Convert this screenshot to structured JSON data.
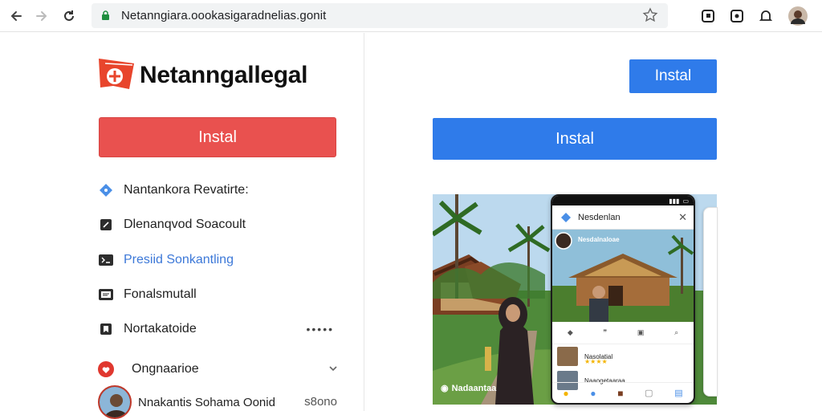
{
  "browser": {
    "url": "Netanngiara.oookasigaradnelias.gonit",
    "back_icon": "arrow-left-icon",
    "forward_icon": "arrow-right-icon",
    "reload_icon": "reload-icon",
    "bookmark_icon": "star-icon"
  },
  "app": {
    "title": "Netanngallegal",
    "install_primary": "Instal"
  },
  "menu": {
    "items": [
      {
        "label": "Nantankora Revatirte:",
        "icon": "tag-icon",
        "link": false
      },
      {
        "label": "Dlenanqvod Soacoult",
        "icon": "edit-icon",
        "link": false
      },
      {
        "label": "Presiid Sonkantling",
        "icon": "terminal-icon",
        "link": true
      },
      {
        "label": "Fonalsmutall",
        "icon": "screen-icon",
        "link": false
      },
      {
        "label": "Nortakatoide",
        "icon": "bookmark-icon",
        "more": "•••••",
        "link": false
      },
      {
        "label": "Ongnaarioe",
        "icon": "heart-icon",
        "link": false
      }
    ]
  },
  "account": {
    "name": "Nnakantis Sohama Oonid",
    "count": "s8ono"
  },
  "right": {
    "install_small": "Instal",
    "install_large": "Instal"
  },
  "preview": {
    "card_title": "Nesdenlan",
    "post_caption": "Nesdalnaloae",
    "list_item": "Nasolatial",
    "list_stars": "★★★★",
    "list_item2": "Naaogetaaraa",
    "hero_caption": "Nadaantaa"
  },
  "colors": {
    "install_red": "#e9514f",
    "install_blue": "#2f7bea",
    "link_blue": "#3c78d8"
  }
}
